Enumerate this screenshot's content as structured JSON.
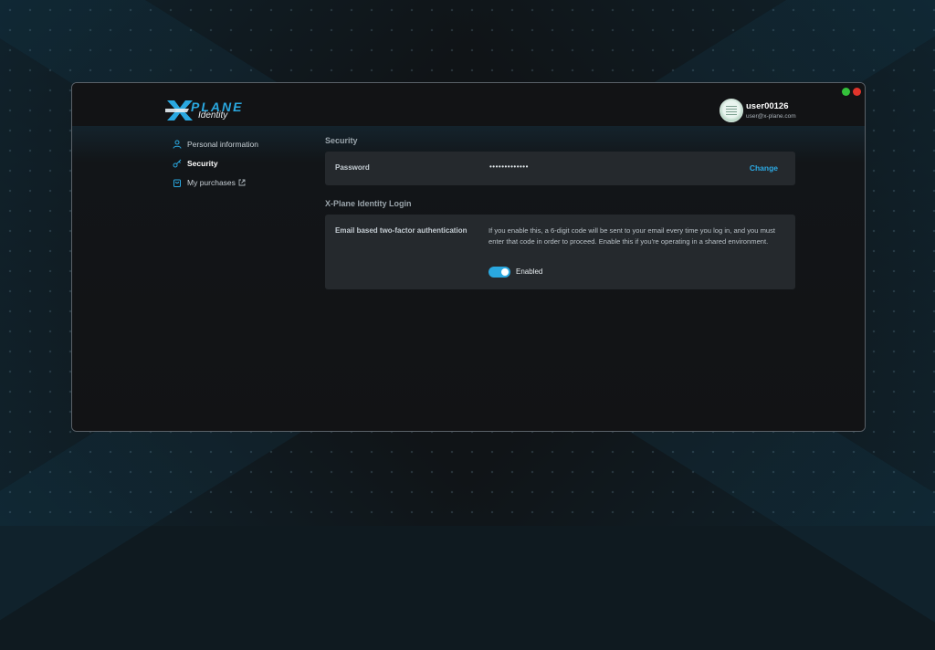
{
  "brand": {
    "logo_main": "PLANE",
    "logo_sub": "Identity",
    "accent_color": "#2aa8e0"
  },
  "user": {
    "name": "user00126",
    "email": "user@x-plane.com"
  },
  "sidebar": {
    "items": [
      {
        "label": "Personal information",
        "icon": "person-icon",
        "active": false
      },
      {
        "label": "Security",
        "icon": "key-icon",
        "active": true
      },
      {
        "label": "My purchases",
        "icon": "bag-icon",
        "active": false,
        "external": true
      }
    ]
  },
  "security": {
    "section_title": "Security",
    "password_label": "Password",
    "password_value": "•••••••••••••",
    "change_label": "Change"
  },
  "identity_login": {
    "section_title": "X-Plane Identity Login",
    "twofa_label": "Email based two-factor authentication",
    "twofa_description": "If you enable this, a 6-digit code will be sent to your email every time you log in, and you must enter that code in order to proceed. Enable this if you're operating in a shared environment.",
    "toggle_state": "on",
    "toggle_label": "Enabled"
  },
  "window_controls": {
    "green_color": "#34c13a",
    "red_color": "#e0342b"
  }
}
